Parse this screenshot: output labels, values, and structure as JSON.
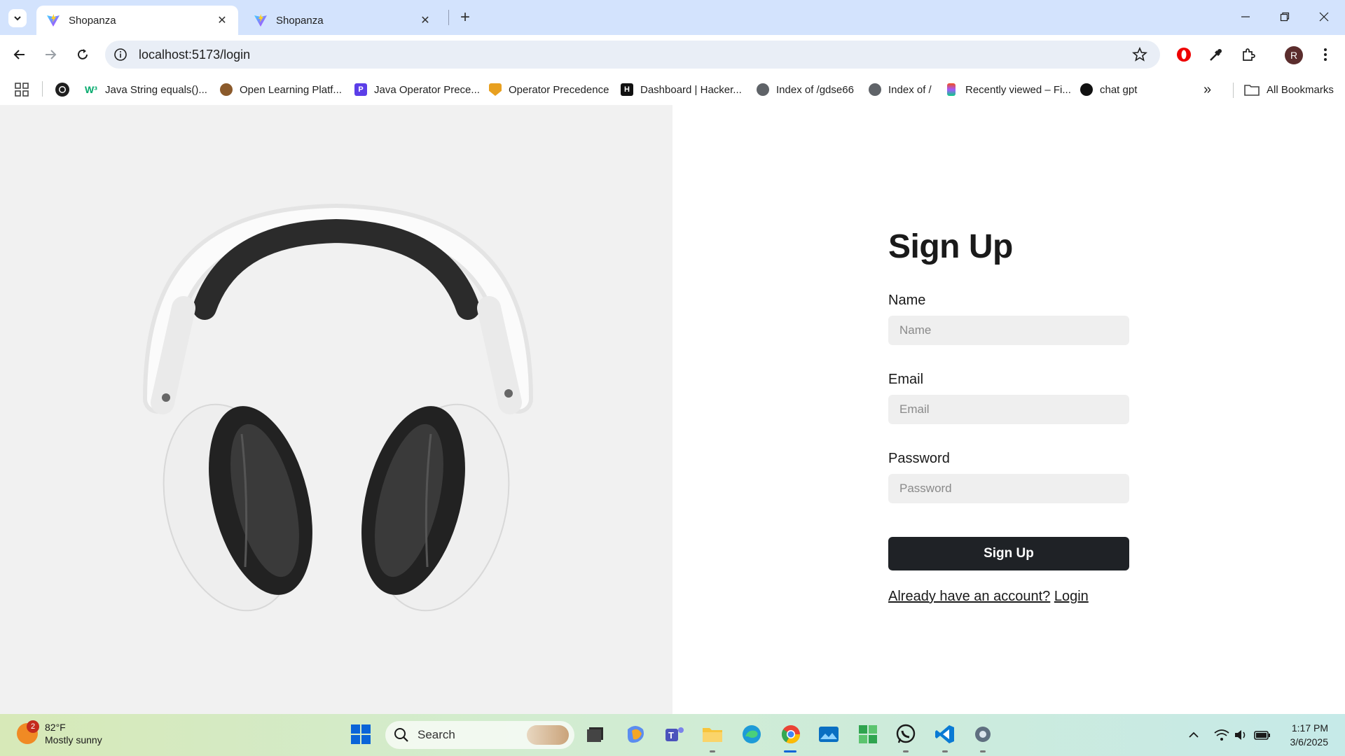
{
  "browser": {
    "tabs": [
      {
        "title": "Shopanza",
        "active": true
      },
      {
        "title": "Shopanza",
        "active": false
      }
    ],
    "url": "localhost:5173/login",
    "profile_initial": "R",
    "bookmarks": [
      {
        "label": "Java String equals()...",
        "icon": "w3-icon"
      },
      {
        "label": "Open Learning Platf...",
        "icon": "learning-icon"
      },
      {
        "label": "Java Operator Prece...",
        "icon": "p-icon"
      },
      {
        "label": "Operator Precedence",
        "icon": "shield-icon"
      },
      {
        "label": "Dashboard | Hacker...",
        "icon": "hackerrank-icon"
      },
      {
        "label": "Index of /gdse66",
        "icon": "globe-icon"
      },
      {
        "label": "Index of /",
        "icon": "globe-icon"
      },
      {
        "label": "Recently viewed – Fi...",
        "icon": "figma-icon"
      },
      {
        "label": "chat gpt",
        "icon": "openai-icon"
      }
    ],
    "all_bookmarks": "All Bookmarks"
  },
  "page": {
    "hero_image": "headphones-image",
    "form": {
      "title": "Sign Up",
      "name_label": "Name",
      "name_placeholder": "Name",
      "email_label": "Email",
      "email_placeholder": "Email",
      "password_label": "Password",
      "password_placeholder": "Password",
      "submit": "Sign Up",
      "account_prompt": "Already have an account?",
      "login_link": "Login"
    }
  },
  "taskbar": {
    "weather_badge": "2",
    "temperature": "82°F",
    "condition": "Mostly sunny",
    "search_placeholder": "Search",
    "time": "1:17 PM",
    "date": "3/6/2025"
  },
  "colors": {
    "tabstrip": "#d3e3fd",
    "button_dark": "#1f2226",
    "hero_bg": "#f1f1f1"
  }
}
